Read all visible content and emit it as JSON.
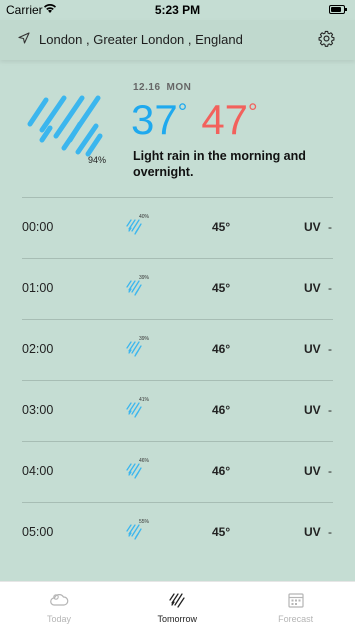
{
  "status_bar": {
    "carrier": "Carrier",
    "time": "5:23 PM"
  },
  "location": {
    "text": "London , Greater London , England",
    "icon": "location-arrow-icon",
    "settings_icon": "gear-icon"
  },
  "summary": {
    "date": "12.16",
    "day": "MON",
    "precip": "94%",
    "temp_low": "37",
    "temp_high": "47",
    "degree_symbol": "°",
    "description": "Light rain in the morning and overnight.",
    "icon": "rain-icon",
    "colors": {
      "low": "#1fa9ee",
      "high": "#f2615c"
    }
  },
  "hours": [
    {
      "time": "00:00",
      "precip": "40%",
      "temp": "45°",
      "uv_label": "UV",
      "uv": "-"
    },
    {
      "time": "01:00",
      "precip": "39%",
      "temp": "45°",
      "uv_label": "UV",
      "uv": "-"
    },
    {
      "time": "02:00",
      "precip": "39%",
      "temp": "46°",
      "uv_label": "UV",
      "uv": "-"
    },
    {
      "time": "03:00",
      "precip": "41%",
      "temp": "46°",
      "uv_label": "UV",
      "uv": "-"
    },
    {
      "time": "04:00",
      "precip": "46%",
      "temp": "46°",
      "uv_label": "UV",
      "uv": "-"
    },
    {
      "time": "05:00",
      "precip": "55%",
      "temp": "45°",
      "uv_label": "UV",
      "uv": "-"
    }
  ],
  "tabs": [
    {
      "label": "Today",
      "icon": "cloud-icon",
      "active": false
    },
    {
      "label": "Tomorrow",
      "icon": "rain-icon",
      "active": true
    },
    {
      "label": "Forecast",
      "icon": "calendar-icon",
      "active": false
    }
  ]
}
